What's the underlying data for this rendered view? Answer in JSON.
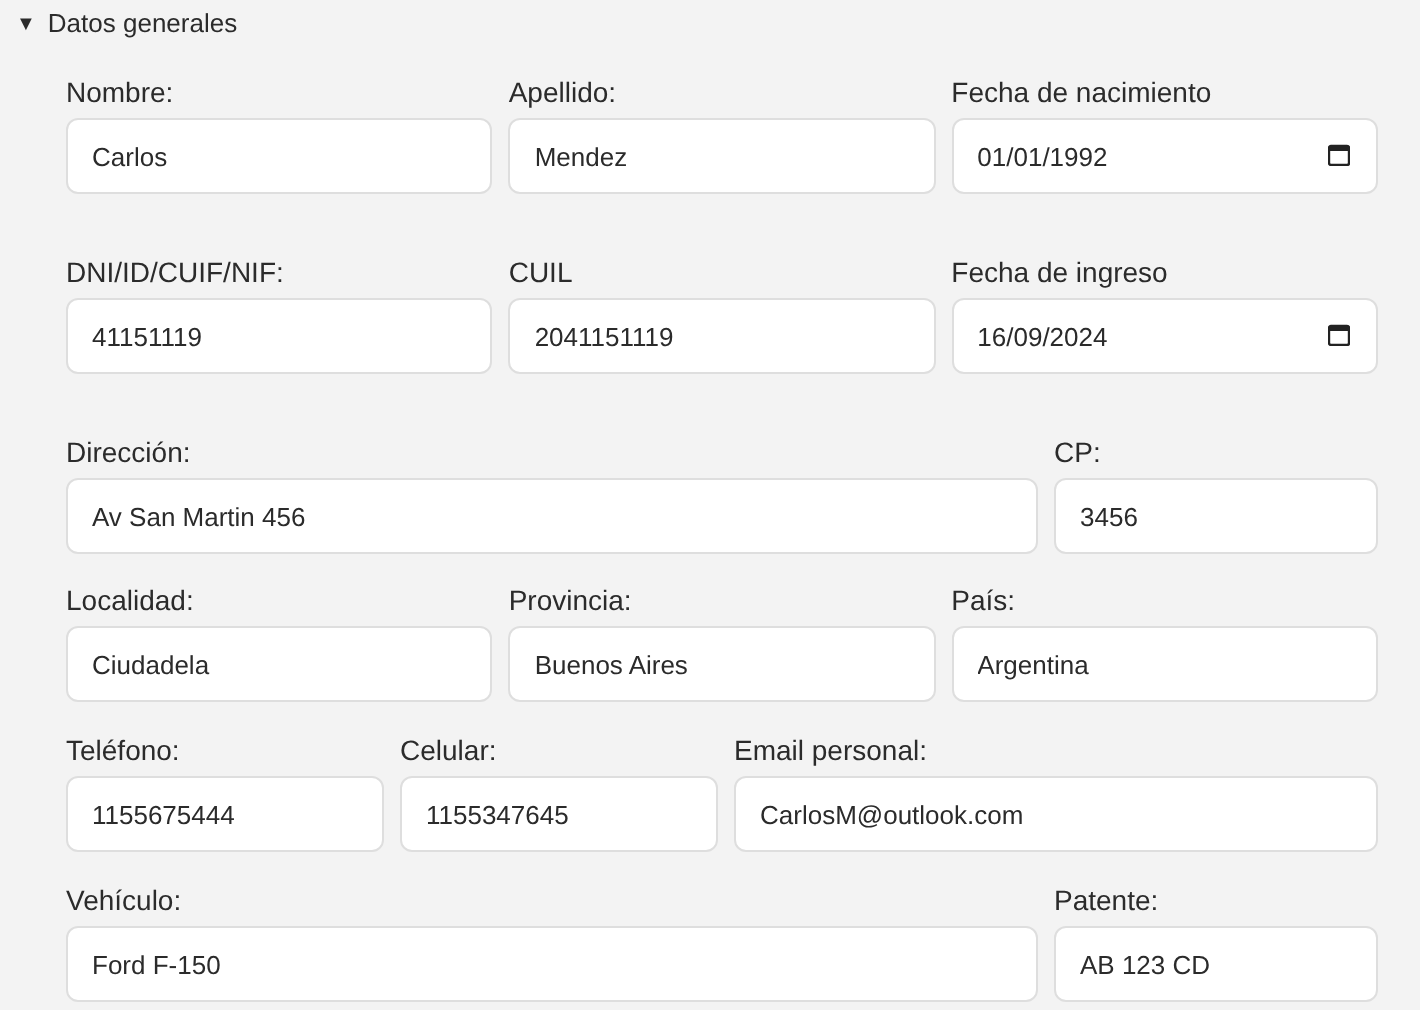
{
  "section": {
    "title": "Datos generales",
    "expanded": true,
    "toggle": "▼"
  },
  "rows": [
    {
      "fields": [
        {
          "label": "Nombre:",
          "kind": "text",
          "value": "Carlos"
        },
        {
          "label": "Apellido:",
          "kind": "text",
          "value": "Mendez"
        },
        {
          "label": "Fecha de nacimiento",
          "kind": "date",
          "value": "01/01/1992"
        }
      ]
    },
    {
      "fields": [
        {
          "label": "DNI/ID/CUIF/NIF:",
          "kind": "text",
          "value": "41151119"
        },
        {
          "label": "CUIL",
          "kind": "text",
          "value": "2041151119"
        },
        {
          "label": "Fecha de ingreso",
          "kind": "date",
          "value": "16/09/2024"
        }
      ]
    },
    {
      "fields": [
        {
          "label": "Dirección:",
          "kind": "text",
          "value": "Av San Martin 456"
        },
        {
          "label": "CP:",
          "kind": "text",
          "value": "3456"
        }
      ]
    },
    {
      "fields": [
        {
          "label": "Localidad:",
          "kind": "text",
          "value": "Ciudadela"
        },
        {
          "label": "Provincia:",
          "kind": "text",
          "value": "Buenos Aires"
        },
        {
          "label": "País:",
          "kind": "text",
          "value": "Argentina"
        }
      ]
    },
    {
      "fields": [
        {
          "label": "Teléfono:",
          "kind": "text",
          "value": "1155675444"
        },
        {
          "label": "Celular:",
          "kind": "text",
          "value": "1155347645"
        },
        {
          "label": "Email personal:",
          "kind": "text",
          "value": "CarlosM@outlook.com"
        }
      ]
    },
    {
      "fields": [
        {
          "label": "Vehículo:",
          "kind": "text",
          "value": "Ford F-150"
        },
        {
          "label": "Patente:",
          "kind": "text",
          "value": "AB 123 CD"
        }
      ]
    }
  ]
}
